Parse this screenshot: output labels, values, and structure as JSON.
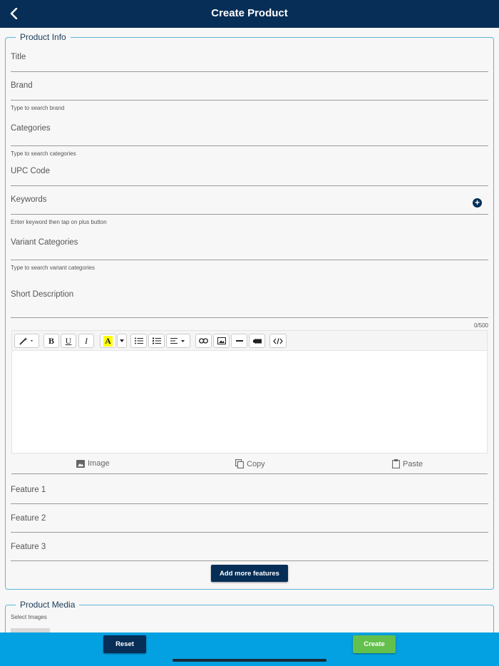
{
  "header": {
    "title": "Create Product",
    "back_icon": "chevron-left-icon"
  },
  "product_info": {
    "legend": "Product Info",
    "fields": {
      "title": "Title",
      "brand": "Brand",
      "brand_hint": "Type to search brand",
      "categories": "Categories",
      "categories_hint": "Type to search categories",
      "upc": "UPC Code",
      "keywords": "Keywords",
      "keywords_hint": "Enter keyword then tap on plus button",
      "variant_categories": "Variant Categories",
      "variant_hint": "Type to search variant categories",
      "short_description": "Short Description",
      "counter": "0/500"
    },
    "editor": {
      "actions": {
        "image": "Image",
        "copy": "Copy",
        "paste": "Paste"
      }
    },
    "features": [
      "Feature 1",
      "Feature 2",
      "Feature 3"
    ],
    "add_more_label": "Add more features"
  },
  "product_media": {
    "legend": "Product Media",
    "hint": "Select Images"
  },
  "footer": {
    "reset_label": "Reset",
    "create_label": "Create"
  },
  "colors": {
    "navy": "#062e57",
    "accent_blue": "#03a1e2",
    "green": "#64c04c",
    "border": "#5fb5d8"
  }
}
